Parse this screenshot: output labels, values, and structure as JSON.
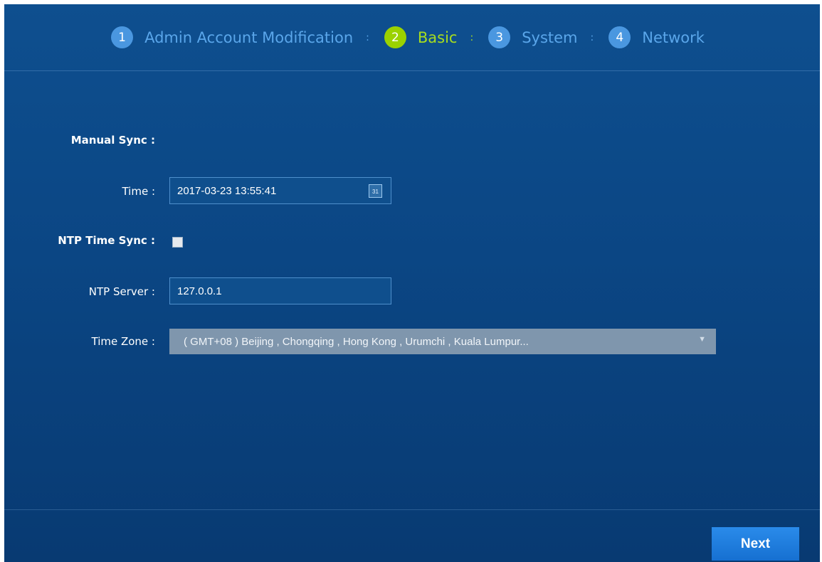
{
  "wizard": {
    "steps": [
      {
        "number": "1",
        "label": "Admin Account Modification",
        "active": false
      },
      {
        "number": "2",
        "label": "Basic",
        "active": true
      },
      {
        "number": "3",
        "label": "System",
        "active": false
      },
      {
        "number": "4",
        "label": "Network",
        "active": false
      }
    ],
    "separator": ":",
    "active_color": "#9bd200",
    "inactive_color": "#4a97e0"
  },
  "form": {
    "manual_sync_label": "Manual Sync :",
    "time_label": "Time :",
    "time_value": "2017-03-23 13:55:41",
    "calendar_icon": "calendar-icon",
    "calendar_icon_text": "31",
    "ntp_sync_label": "NTP Time Sync :",
    "ntp_sync_checked": false,
    "ntp_server_label": "NTP Server :",
    "ntp_server_value": "127.0.0.1",
    "time_zone_label": "Time Zone :",
    "time_zone_value": "( GMT+08 ) Beijing , Chongqing , Hong Kong , Urumchi , Kuala Lumpur...",
    "time_zone_arrow": "▼"
  },
  "footer": {
    "next_label": "Next"
  }
}
